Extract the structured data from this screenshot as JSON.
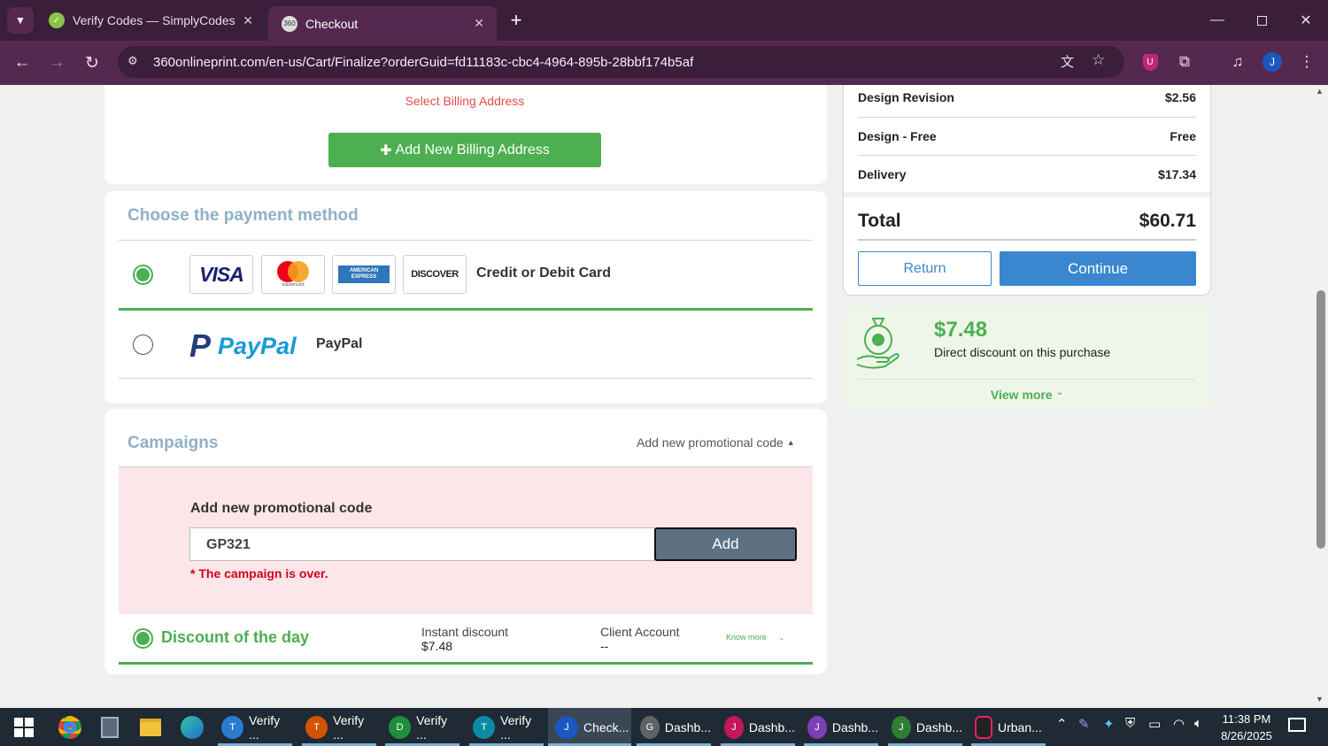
{
  "browser": {
    "tabs": [
      {
        "title": "Verify Codes — SimplyCodes",
        "active": false
      },
      {
        "title": "Checkout",
        "active": true
      }
    ],
    "new_tab_label": "+",
    "url": "360onlineprint.com/en-us/Cart/Finalize?orderGuid=fd11183c-cbc4-4964-895b-28bbf174b5af",
    "profile_initial": "J",
    "accent": "#55294f"
  },
  "billing": {
    "select_label": "Select Billing Address",
    "add_button": "Add New Billing Address"
  },
  "payment": {
    "title": "Choose the payment method",
    "options": [
      {
        "label": "Credit or Debit Card",
        "selected": true,
        "logos": [
          "VISA",
          "mastercard",
          "AMERICAN EXPRESS",
          "DISCOVER"
        ]
      },
      {
        "label": "PayPal",
        "selected": false,
        "logo": "PayPal"
      }
    ]
  },
  "campaigns": {
    "title": "Campaigns",
    "toggle_label": "Add new promotional code",
    "promo_label": "Add new promotional code",
    "promo_value": "GP321",
    "add_button": "Add",
    "error": "* The campaign is over.",
    "discount_row": {
      "title": "Discount of the day",
      "instant_label": "Instant discount",
      "instant_value": "$7.48",
      "client_label": "Client Account",
      "client_value": "--",
      "know_more": "Know more"
    }
  },
  "summary": {
    "rows": [
      {
        "label": "Design Revision",
        "value": "$2.56"
      },
      {
        "label": "Design - Free",
        "value": "Free"
      },
      {
        "label": "Delivery",
        "value": "$17.34"
      }
    ],
    "total_label": "Total",
    "total_value": "$60.71",
    "return_button": "Return",
    "continue_button": "Continue"
  },
  "discount_card": {
    "amount": "$7.48",
    "text": "Direct discount on this purchase",
    "view_more": "View more"
  },
  "taskbar": {
    "apps": [
      {
        "label": "Verify ...",
        "badge": "T"
      },
      {
        "label": "Verify ...",
        "badge": "T"
      },
      {
        "label": "Verify ...",
        "badge": "D"
      },
      {
        "label": "Verify ...",
        "badge": "T"
      },
      {
        "label": "Check...",
        "badge": "J"
      },
      {
        "label": "Dashb...",
        "badge": "G"
      },
      {
        "label": "Dashb...",
        "badge": "J"
      },
      {
        "label": "Dashb...",
        "badge": "J"
      },
      {
        "label": "Dashb...",
        "badge": "J"
      },
      {
        "label": "Urban...",
        "badge": ""
      }
    ],
    "time": "11:38 PM",
    "date": "8/26/2025"
  },
  "colors": {
    "green": "#4caf50",
    "blue_button": "#3a87cf",
    "promo_bg": "#fce6ea",
    "title_blue": "#8fb0c7",
    "error_red": "#d0021b"
  }
}
